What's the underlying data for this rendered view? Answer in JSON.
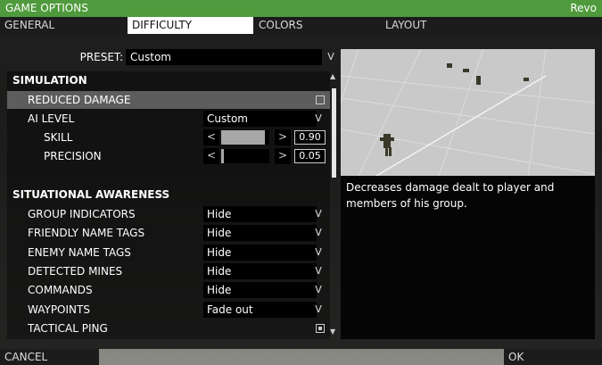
{
  "window": {
    "title": "GAME OPTIONS",
    "user": "Revo"
  },
  "tabs": [
    {
      "label": "GENERAL"
    },
    {
      "label": "DIFFICULTY",
      "active": true
    },
    {
      "label": "COLORS"
    },
    {
      "label": "LAYOUT"
    }
  ],
  "preset": {
    "label": "PRESET:",
    "value": "Custom"
  },
  "simulation": {
    "header": "SIMULATION",
    "reduced_damage": {
      "label": "REDUCED DAMAGE",
      "checked": false
    },
    "ai_level": {
      "label": "AI LEVEL",
      "value": "Custom"
    },
    "skill": {
      "label": "SKILL",
      "value": "0.90",
      "level": 0.9
    },
    "precision": {
      "label": "PRECISION",
      "value": "0.05",
      "level": 0.05
    }
  },
  "awareness": {
    "header": "SITUATIONAL AWARENESS",
    "items": [
      {
        "label": "GROUP INDICATORS",
        "value": "Hide"
      },
      {
        "label": "FRIENDLY NAME TAGS",
        "value": "Hide"
      },
      {
        "label": "ENEMY NAME TAGS",
        "value": "Hide"
      },
      {
        "label": "DETECTED MINES",
        "value": "Hide"
      },
      {
        "label": "COMMANDS",
        "value": "Hide"
      },
      {
        "label": "WAYPOINTS",
        "value": "Fade out"
      }
    ],
    "tactical_ping": {
      "label": "TACTICAL PING",
      "checked": true
    }
  },
  "slider_arrows": {
    "left": "<",
    "right": ">"
  },
  "chevron": "V",
  "description": "Decreases damage dealt to player and members of his group.",
  "buttons": {
    "cancel": "CANCEL",
    "ok": "OK"
  },
  "colors": {
    "title_bar": "#4f9a3c",
    "highlight": "#5d5d5d"
  }
}
